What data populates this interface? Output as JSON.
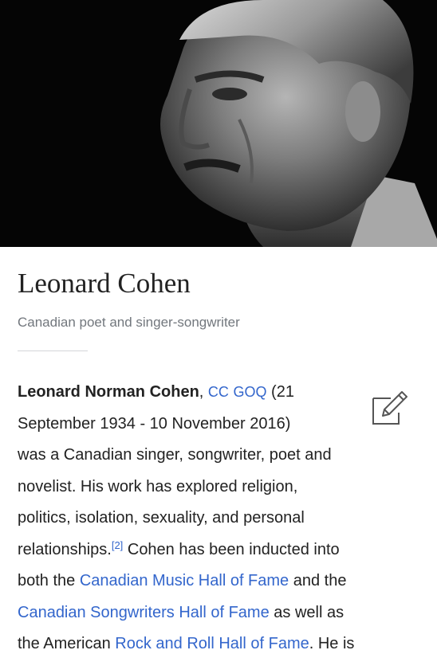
{
  "article": {
    "title": "Leonard Cohen",
    "description": "Canadian poet and singer-songwriter",
    "lead": {
      "name_bold": "Leonard Norman Cohen",
      "after_name": ", ",
      "honours": [
        {
          "label": "CC"
        },
        {
          "label": "GOQ"
        }
      ],
      "line1_tail": " (21",
      "line2": "September 1934 - 10 November 2016)",
      "line3": "was a Canadian singer, songwriter, poet and",
      "line4": "novelist. His work has explored religion,",
      "line5": "politics, isolation, sexuality, and personal",
      "line6_start": "relationships.",
      "reference": "[2]",
      "line6_end": " Cohen has been inducted into",
      "line7_start": "both the ",
      "link_music_hall": "Canadian Music Hall of Fame",
      "line7_end": " and the",
      "link_songwriters_hall": "Canadian Songwriters Hall of Fame",
      "line8_end": " as well as",
      "line9_start": "the American ",
      "link_rock_hall": "Rock and Roll Hall of Fame",
      "line9_end": ". He is"
    }
  },
  "icons": {
    "edit": "pencil-edit-icon"
  },
  "colors": {
    "text": "#222222",
    "link": "#3366cc",
    "description": "#72777d",
    "photo_background": "#050505"
  }
}
